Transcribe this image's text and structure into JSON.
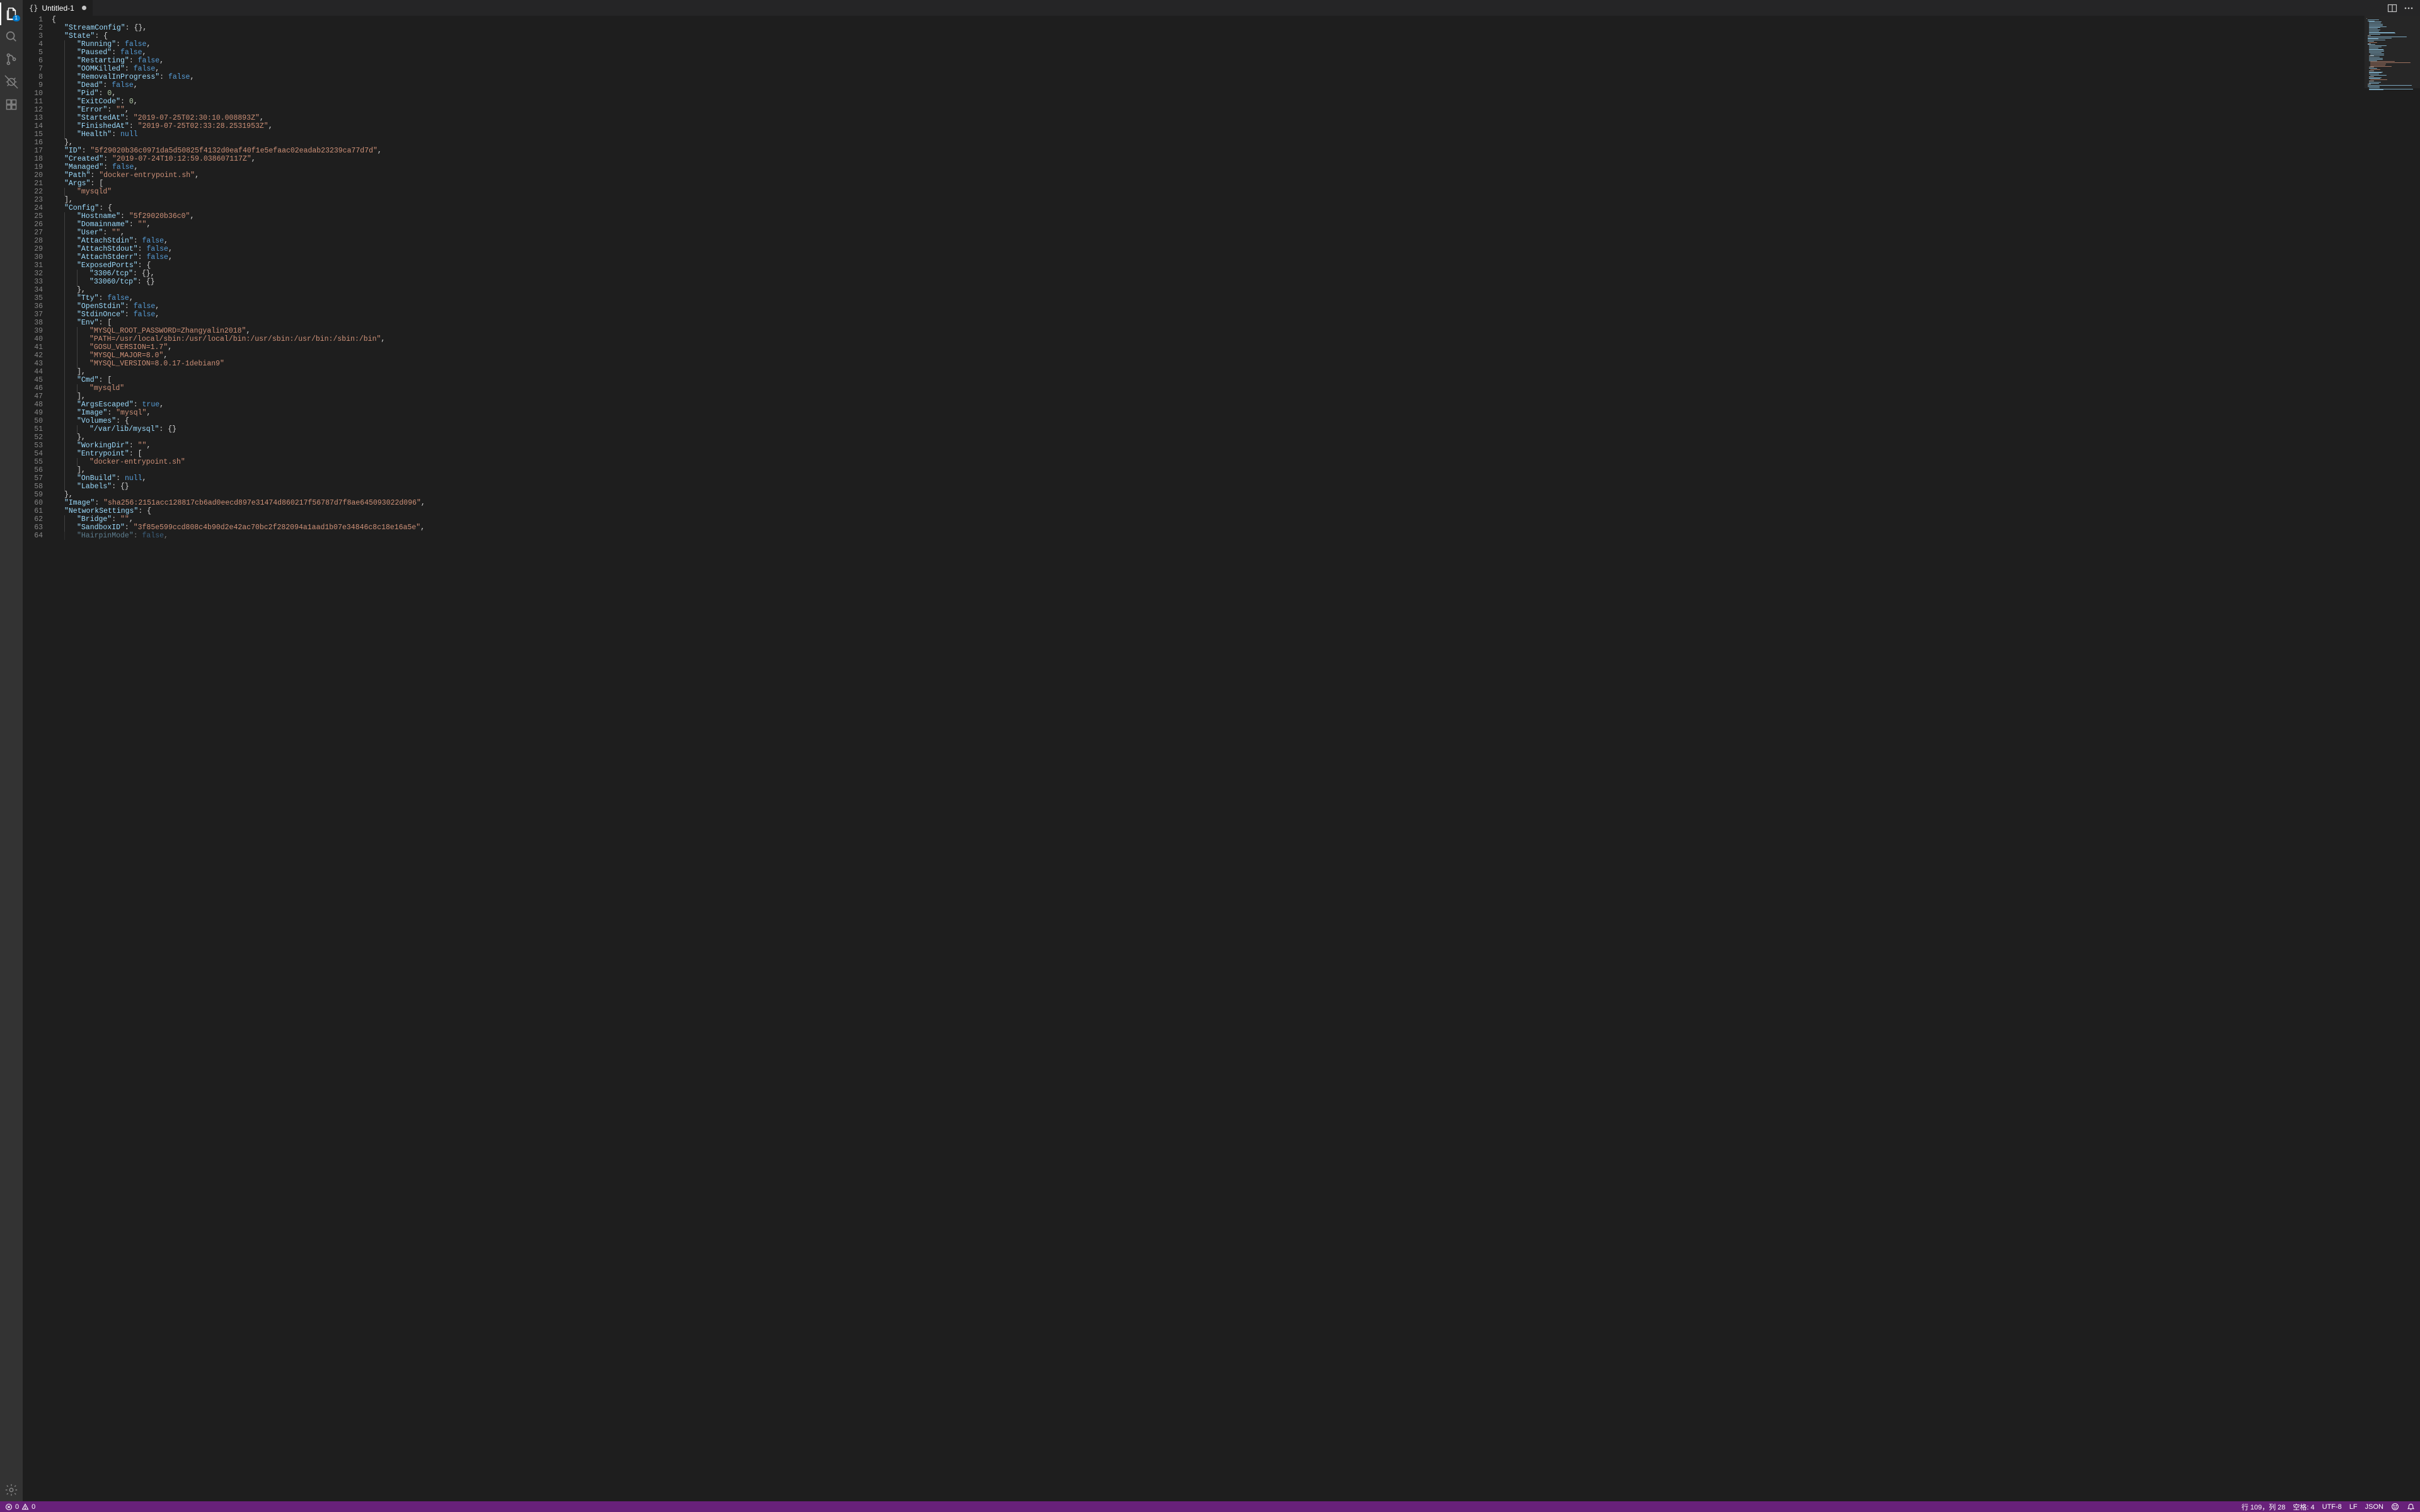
{
  "tab": {
    "filename": "Untitled-1",
    "lang_icon": "{}",
    "dirty": true
  },
  "activity_badge": "1",
  "status": {
    "errors": "0",
    "warnings": "0",
    "cursor": "行 109，列 28",
    "indent": "空格: 4",
    "encoding": "UTF-8",
    "eol": "LF",
    "language": "JSON"
  },
  "code_lines": [
    {
      "n": 1,
      "tokens": [
        {
          "t": "{",
          "c": "punc"
        }
      ]
    },
    {
      "n": 2,
      "indent": 1,
      "tokens": [
        {
          "t": "\"StreamConfig\"",
          "c": "key"
        },
        {
          "t": ": ",
          "c": "punc"
        },
        {
          "t": "{}",
          "c": "punc"
        },
        {
          "t": ",",
          "c": "punc"
        }
      ]
    },
    {
      "n": 3,
      "indent": 1,
      "tokens": [
        {
          "t": "\"State\"",
          "c": "key"
        },
        {
          "t": ": ",
          "c": "punc"
        },
        {
          "t": "{",
          "c": "punc"
        }
      ]
    },
    {
      "n": 4,
      "indent": 2,
      "tokens": [
        {
          "t": "\"Running\"",
          "c": "key"
        },
        {
          "t": ": ",
          "c": "punc"
        },
        {
          "t": "false",
          "c": "kw"
        },
        {
          "t": ",",
          "c": "punc"
        }
      ]
    },
    {
      "n": 5,
      "indent": 2,
      "tokens": [
        {
          "t": "\"Paused\"",
          "c": "key"
        },
        {
          "t": ": ",
          "c": "punc"
        },
        {
          "t": "false",
          "c": "kw"
        },
        {
          "t": ",",
          "c": "punc"
        }
      ]
    },
    {
      "n": 6,
      "indent": 2,
      "tokens": [
        {
          "t": "\"Restarting\"",
          "c": "key"
        },
        {
          "t": ": ",
          "c": "punc"
        },
        {
          "t": "false",
          "c": "kw"
        },
        {
          "t": ",",
          "c": "punc"
        }
      ]
    },
    {
      "n": 7,
      "indent": 2,
      "tokens": [
        {
          "t": "\"OOMKilled\"",
          "c": "key"
        },
        {
          "t": ": ",
          "c": "punc"
        },
        {
          "t": "false",
          "c": "kw"
        },
        {
          "t": ",",
          "c": "punc"
        }
      ]
    },
    {
      "n": 8,
      "indent": 2,
      "tokens": [
        {
          "t": "\"RemovalInProgress\"",
          "c": "key"
        },
        {
          "t": ": ",
          "c": "punc"
        },
        {
          "t": "false",
          "c": "kw"
        },
        {
          "t": ",",
          "c": "punc"
        }
      ]
    },
    {
      "n": 9,
      "indent": 2,
      "tokens": [
        {
          "t": "\"Dead\"",
          "c": "key"
        },
        {
          "t": ": ",
          "c": "punc"
        },
        {
          "t": "false",
          "c": "kw"
        },
        {
          "t": ",",
          "c": "punc"
        }
      ]
    },
    {
      "n": 10,
      "indent": 2,
      "tokens": [
        {
          "t": "\"Pid\"",
          "c": "key"
        },
        {
          "t": ": ",
          "c": "punc"
        },
        {
          "t": "0",
          "c": "num"
        },
        {
          "t": ",",
          "c": "punc"
        }
      ]
    },
    {
      "n": 11,
      "indent": 2,
      "tokens": [
        {
          "t": "\"ExitCode\"",
          "c": "key"
        },
        {
          "t": ": ",
          "c": "punc"
        },
        {
          "t": "0",
          "c": "num"
        },
        {
          "t": ",",
          "c": "punc"
        }
      ]
    },
    {
      "n": 12,
      "indent": 2,
      "tokens": [
        {
          "t": "\"Error\"",
          "c": "key"
        },
        {
          "t": ": ",
          "c": "punc"
        },
        {
          "t": "\"\"",
          "c": "str"
        },
        {
          "t": ",",
          "c": "punc"
        }
      ]
    },
    {
      "n": 13,
      "indent": 2,
      "tokens": [
        {
          "t": "\"StartedAt\"",
          "c": "key"
        },
        {
          "t": ": ",
          "c": "punc"
        },
        {
          "t": "\"2019-07-25T02:30:10.008893Z\"",
          "c": "str"
        },
        {
          "t": ",",
          "c": "punc"
        }
      ]
    },
    {
      "n": 14,
      "indent": 2,
      "tokens": [
        {
          "t": "\"FinishedAt\"",
          "c": "key"
        },
        {
          "t": ": ",
          "c": "punc"
        },
        {
          "t": "\"2019-07-25T02:33:28.2531953Z\"",
          "c": "str"
        },
        {
          "t": ",",
          "c": "punc"
        }
      ]
    },
    {
      "n": 15,
      "indent": 2,
      "tokens": [
        {
          "t": "\"Health\"",
          "c": "key"
        },
        {
          "t": ": ",
          "c": "punc"
        },
        {
          "t": "null",
          "c": "kw"
        }
      ]
    },
    {
      "n": 16,
      "indent": 1,
      "tokens": [
        {
          "t": "},",
          "c": "punc"
        }
      ]
    },
    {
      "n": 17,
      "indent": 1,
      "tokens": [
        {
          "t": "\"ID\"",
          "c": "key"
        },
        {
          "t": ": ",
          "c": "punc"
        },
        {
          "t": "\"5f29020b36c0971da5d50825f4132d0eaf40f1e5efaac02eadab23239ca77d7d\"",
          "c": "str"
        },
        {
          "t": ",",
          "c": "punc"
        }
      ]
    },
    {
      "n": 18,
      "indent": 1,
      "tokens": [
        {
          "t": "\"Created\"",
          "c": "key"
        },
        {
          "t": ": ",
          "c": "punc"
        },
        {
          "t": "\"2019-07-24T10:12:59.038607117Z\"",
          "c": "str"
        },
        {
          "t": ",",
          "c": "punc"
        }
      ]
    },
    {
      "n": 19,
      "indent": 1,
      "tokens": [
        {
          "t": "\"Managed\"",
          "c": "key"
        },
        {
          "t": ": ",
          "c": "punc"
        },
        {
          "t": "false",
          "c": "kw"
        },
        {
          "t": ",",
          "c": "punc"
        }
      ]
    },
    {
      "n": 20,
      "indent": 1,
      "tokens": [
        {
          "t": "\"Path\"",
          "c": "key"
        },
        {
          "t": ": ",
          "c": "punc"
        },
        {
          "t": "\"docker-entrypoint.sh\"",
          "c": "str"
        },
        {
          "t": ",",
          "c": "punc"
        }
      ]
    },
    {
      "n": 21,
      "indent": 1,
      "tokens": [
        {
          "t": "\"Args\"",
          "c": "key"
        },
        {
          "t": ": ",
          "c": "punc"
        },
        {
          "t": "[",
          "c": "punc"
        }
      ]
    },
    {
      "n": 22,
      "indent": 2,
      "tokens": [
        {
          "t": "\"mysqld\"",
          "c": "str"
        }
      ]
    },
    {
      "n": 23,
      "indent": 1,
      "tokens": [
        {
          "t": "],",
          "c": "punc"
        }
      ]
    },
    {
      "n": 24,
      "indent": 1,
      "tokens": [
        {
          "t": "\"Config\"",
          "c": "key"
        },
        {
          "t": ": ",
          "c": "punc"
        },
        {
          "t": "{",
          "c": "punc"
        }
      ]
    },
    {
      "n": 25,
      "indent": 2,
      "tokens": [
        {
          "t": "\"Hostname\"",
          "c": "key"
        },
        {
          "t": ": ",
          "c": "punc"
        },
        {
          "t": "\"5f29020b36c0\"",
          "c": "str"
        },
        {
          "t": ",",
          "c": "punc"
        }
      ]
    },
    {
      "n": 26,
      "indent": 2,
      "tokens": [
        {
          "t": "\"Domainname\"",
          "c": "key"
        },
        {
          "t": ": ",
          "c": "punc"
        },
        {
          "t": "\"\"",
          "c": "str"
        },
        {
          "t": ",",
          "c": "punc"
        }
      ]
    },
    {
      "n": 27,
      "indent": 2,
      "tokens": [
        {
          "t": "\"User\"",
          "c": "key"
        },
        {
          "t": ": ",
          "c": "punc"
        },
        {
          "t": "\"\"",
          "c": "str"
        },
        {
          "t": ",",
          "c": "punc"
        }
      ]
    },
    {
      "n": 28,
      "indent": 2,
      "tokens": [
        {
          "t": "\"AttachStdin\"",
          "c": "key"
        },
        {
          "t": ": ",
          "c": "punc"
        },
        {
          "t": "false",
          "c": "kw"
        },
        {
          "t": ",",
          "c": "punc"
        }
      ]
    },
    {
      "n": 29,
      "indent": 2,
      "tokens": [
        {
          "t": "\"AttachStdout\"",
          "c": "key"
        },
        {
          "t": ": ",
          "c": "punc"
        },
        {
          "t": "false",
          "c": "kw"
        },
        {
          "t": ",",
          "c": "punc"
        }
      ]
    },
    {
      "n": 30,
      "indent": 2,
      "tokens": [
        {
          "t": "\"AttachStderr\"",
          "c": "key"
        },
        {
          "t": ": ",
          "c": "punc"
        },
        {
          "t": "false",
          "c": "kw"
        },
        {
          "t": ",",
          "c": "punc"
        }
      ]
    },
    {
      "n": 31,
      "indent": 2,
      "tokens": [
        {
          "t": "\"ExposedPorts\"",
          "c": "key"
        },
        {
          "t": ": ",
          "c": "punc"
        },
        {
          "t": "{",
          "c": "punc"
        }
      ]
    },
    {
      "n": 32,
      "indent": 3,
      "tokens": [
        {
          "t": "\"3306/tcp\"",
          "c": "key"
        },
        {
          "t": ": ",
          "c": "punc"
        },
        {
          "t": "{}",
          "c": "punc"
        },
        {
          "t": ",",
          "c": "punc"
        }
      ]
    },
    {
      "n": 33,
      "indent": 3,
      "tokens": [
        {
          "t": "\"33060/tcp\"",
          "c": "key"
        },
        {
          "t": ": ",
          "c": "punc"
        },
        {
          "t": "{}",
          "c": "punc"
        }
      ]
    },
    {
      "n": 34,
      "indent": 2,
      "tokens": [
        {
          "t": "},",
          "c": "punc"
        }
      ]
    },
    {
      "n": 35,
      "indent": 2,
      "tokens": [
        {
          "t": "\"Tty\"",
          "c": "key"
        },
        {
          "t": ": ",
          "c": "punc"
        },
        {
          "t": "false",
          "c": "kw"
        },
        {
          "t": ",",
          "c": "punc"
        }
      ]
    },
    {
      "n": 36,
      "indent": 2,
      "tokens": [
        {
          "t": "\"OpenStdin\"",
          "c": "key"
        },
        {
          "t": ": ",
          "c": "punc"
        },
        {
          "t": "false",
          "c": "kw"
        },
        {
          "t": ",",
          "c": "punc"
        }
      ]
    },
    {
      "n": 37,
      "indent": 2,
      "tokens": [
        {
          "t": "\"StdinOnce\"",
          "c": "key"
        },
        {
          "t": ": ",
          "c": "punc"
        },
        {
          "t": "false",
          "c": "kw"
        },
        {
          "t": ",",
          "c": "punc"
        }
      ]
    },
    {
      "n": 38,
      "indent": 2,
      "tokens": [
        {
          "t": "\"Env\"",
          "c": "key"
        },
        {
          "t": ": ",
          "c": "punc"
        },
        {
          "t": "[",
          "c": "punc"
        }
      ]
    },
    {
      "n": 39,
      "indent": 3,
      "tokens": [
        {
          "t": "\"MYSQL_ROOT_PASSWORD=Zhangyalin2018\"",
          "c": "str"
        },
        {
          "t": ",",
          "c": "punc"
        }
      ]
    },
    {
      "n": 40,
      "indent": 3,
      "tokens": [
        {
          "t": "\"PATH=/usr/local/sbin:/usr/local/bin:/usr/sbin:/usr/bin:/sbin:/bin\"",
          "c": "str"
        },
        {
          "t": ",",
          "c": "punc"
        }
      ]
    },
    {
      "n": 41,
      "indent": 3,
      "tokens": [
        {
          "t": "\"GOSU_VERSION=1.7\"",
          "c": "str"
        },
        {
          "t": ",",
          "c": "punc"
        }
      ]
    },
    {
      "n": 42,
      "indent": 3,
      "tokens": [
        {
          "t": "\"MYSQL_MAJOR=8.0\"",
          "c": "str"
        },
        {
          "t": ",",
          "c": "punc"
        }
      ]
    },
    {
      "n": 43,
      "indent": 3,
      "tokens": [
        {
          "t": "\"MYSQL_VERSION=8.0.17-1debian9\"",
          "c": "str"
        }
      ]
    },
    {
      "n": 44,
      "indent": 2,
      "tokens": [
        {
          "t": "],",
          "c": "punc"
        }
      ]
    },
    {
      "n": 45,
      "indent": 2,
      "tokens": [
        {
          "t": "\"Cmd\"",
          "c": "key"
        },
        {
          "t": ": ",
          "c": "punc"
        },
        {
          "t": "[",
          "c": "punc"
        }
      ]
    },
    {
      "n": 46,
      "indent": 3,
      "tokens": [
        {
          "t": "\"mysqld\"",
          "c": "str"
        }
      ]
    },
    {
      "n": 47,
      "indent": 2,
      "tokens": [
        {
          "t": "],",
          "c": "punc"
        }
      ]
    },
    {
      "n": 48,
      "indent": 2,
      "tokens": [
        {
          "t": "\"ArgsEscaped\"",
          "c": "key"
        },
        {
          "t": ": ",
          "c": "punc"
        },
        {
          "t": "true",
          "c": "kw"
        },
        {
          "t": ",",
          "c": "punc"
        }
      ]
    },
    {
      "n": 49,
      "indent": 2,
      "tokens": [
        {
          "t": "\"Image\"",
          "c": "key"
        },
        {
          "t": ": ",
          "c": "punc"
        },
        {
          "t": "\"mysql\"",
          "c": "str"
        },
        {
          "t": ",",
          "c": "punc"
        }
      ]
    },
    {
      "n": 50,
      "indent": 2,
      "tokens": [
        {
          "t": "\"Volumes\"",
          "c": "key"
        },
        {
          "t": ": ",
          "c": "punc"
        },
        {
          "t": "{",
          "c": "punc"
        }
      ]
    },
    {
      "n": 51,
      "indent": 3,
      "tokens": [
        {
          "t": "\"/var/lib/mysql\"",
          "c": "key"
        },
        {
          "t": ": ",
          "c": "punc"
        },
        {
          "t": "{}",
          "c": "punc"
        }
      ]
    },
    {
      "n": 52,
      "indent": 2,
      "tokens": [
        {
          "t": "},",
          "c": "punc"
        }
      ]
    },
    {
      "n": 53,
      "indent": 2,
      "tokens": [
        {
          "t": "\"WorkingDir\"",
          "c": "key"
        },
        {
          "t": ": ",
          "c": "punc"
        },
        {
          "t": "\"\"",
          "c": "str"
        },
        {
          "t": ",",
          "c": "punc"
        }
      ]
    },
    {
      "n": 54,
      "indent": 2,
      "tokens": [
        {
          "t": "\"Entrypoint\"",
          "c": "key"
        },
        {
          "t": ": ",
          "c": "punc"
        },
        {
          "t": "[",
          "c": "punc"
        }
      ]
    },
    {
      "n": 55,
      "indent": 3,
      "tokens": [
        {
          "t": "\"docker-entrypoint.sh\"",
          "c": "str"
        }
      ]
    },
    {
      "n": 56,
      "indent": 2,
      "tokens": [
        {
          "t": "],",
          "c": "punc"
        }
      ]
    },
    {
      "n": 57,
      "indent": 2,
      "tokens": [
        {
          "t": "\"OnBuild\"",
          "c": "key"
        },
        {
          "t": ": ",
          "c": "punc"
        },
        {
          "t": "null",
          "c": "kw"
        },
        {
          "t": ",",
          "c": "punc"
        }
      ]
    },
    {
      "n": 58,
      "indent": 2,
      "tokens": [
        {
          "t": "\"Labels\"",
          "c": "key"
        },
        {
          "t": ": ",
          "c": "punc"
        },
        {
          "t": "{}",
          "c": "punc"
        }
      ]
    },
    {
      "n": 59,
      "indent": 1,
      "tokens": [
        {
          "t": "},",
          "c": "punc"
        }
      ]
    },
    {
      "n": 60,
      "indent": 1,
      "tokens": [
        {
          "t": "\"Image\"",
          "c": "key"
        },
        {
          "t": ": ",
          "c": "punc"
        },
        {
          "t": "\"sha256:2151acc128817cb6ad0eecd897e31474d860217f56787d7f8ae645093022d096\"",
          "c": "str"
        },
        {
          "t": ",",
          "c": "punc"
        }
      ]
    },
    {
      "n": 61,
      "indent": 1,
      "tokens": [
        {
          "t": "\"NetworkSettings\"",
          "c": "key"
        },
        {
          "t": ": ",
          "c": "punc"
        },
        {
          "t": "{",
          "c": "punc"
        }
      ]
    },
    {
      "n": 62,
      "indent": 2,
      "tokens": [
        {
          "t": "\"Bridge\"",
          "c": "key"
        },
        {
          "t": ": ",
          "c": "punc"
        },
        {
          "t": "\"\"",
          "c": "str"
        },
        {
          "t": ",",
          "c": "punc"
        }
      ]
    },
    {
      "n": 63,
      "indent": 2,
      "tokens": [
        {
          "t": "\"SandboxID\"",
          "c": "key"
        },
        {
          "t": ": ",
          "c": "punc"
        },
        {
          "t": "\"3f85e599ccd808c4b90d2e42ac70bc2f282094a1aad1b07e34846c8c18e16a5e\"",
          "c": "str"
        },
        {
          "t": ",",
          "c": "punc"
        }
      ]
    },
    {
      "n": 64,
      "indent": 2,
      "tokens": [
        {
          "t": "\"HairpinMode\"",
          "c": "key"
        },
        {
          "t": ": ",
          "c": "punc"
        },
        {
          "t": "false",
          "c": "kw"
        },
        {
          "t": ",",
          "c": "punc"
        }
      ],
      "cut": true
    }
  ]
}
